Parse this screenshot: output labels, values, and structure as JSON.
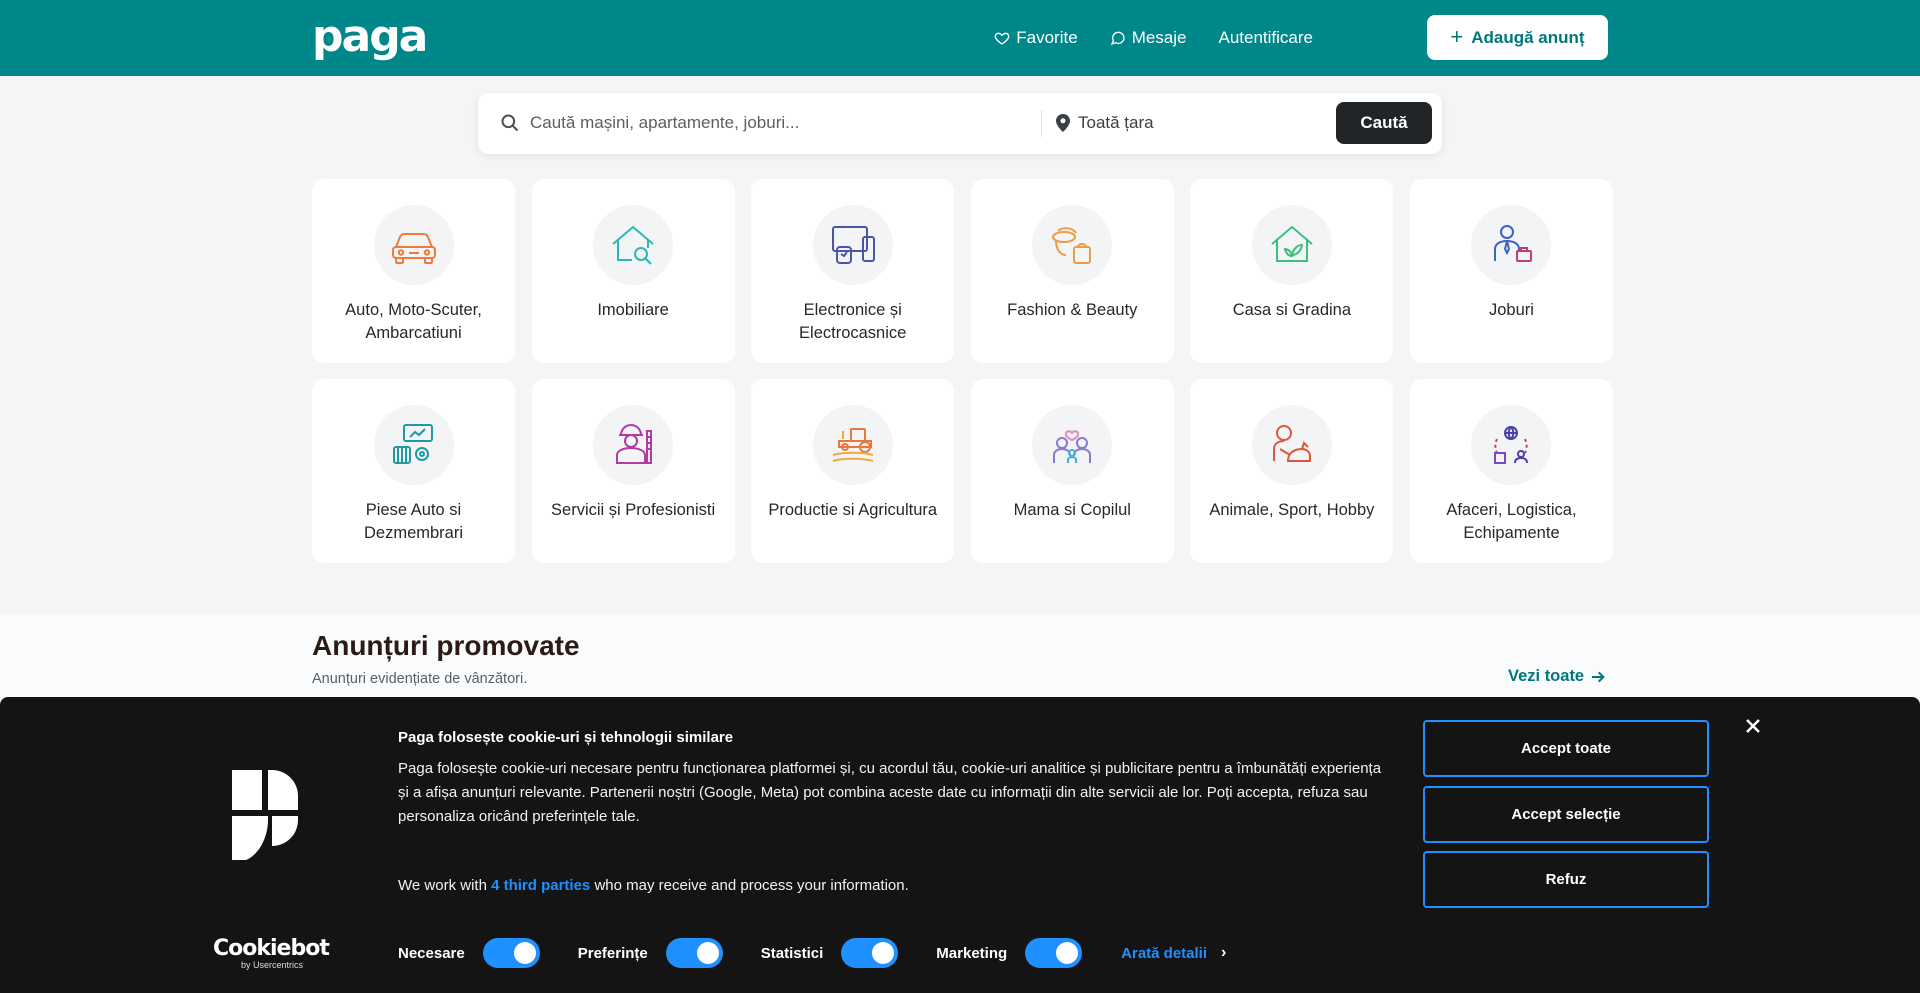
{
  "header": {
    "logo": "paga",
    "nav": {
      "favorites": "Favorite",
      "messages": "Mesaje",
      "login": "Autentificare"
    },
    "add_listing": "Adaugă anunț",
    "bg_color": "#00878a"
  },
  "search": {
    "placeholder": "Caută mașini, apartamente, joburi...",
    "location": "Toată țara",
    "button": "Caută"
  },
  "categories": [
    {
      "label": "Auto, Moto-Scuter, Ambarcatiuni",
      "icon": "car-icon"
    },
    {
      "label": "Imobiliare",
      "icon": "house-search-icon"
    },
    {
      "label": "Electronice și Electrocasnice",
      "icon": "devices-icon"
    },
    {
      "label": "Fashion & Beauty",
      "icon": "fashion-icon"
    },
    {
      "label": "Casa si Gradina",
      "icon": "house-leaf-icon"
    },
    {
      "label": "Joburi",
      "icon": "worker-briefcase-icon"
    },
    {
      "label": "Piese Auto si Dezmembrari",
      "icon": "car-parts-icon"
    },
    {
      "label": "Servicii și Profesionisti",
      "icon": "builder-icon"
    },
    {
      "label": "Productie si Agricultura",
      "icon": "tractor-icon"
    },
    {
      "label": "Mama si Copilul",
      "icon": "family-icon"
    },
    {
      "label": "Animale, Sport, Hobby",
      "icon": "pet-icon"
    },
    {
      "label": "Afaceri, Logistica, Echipamente",
      "icon": "logistics-icon"
    }
  ],
  "promoted": {
    "title": "Anunțuri promovate",
    "subtitle": "Anunțuri evidențiate de vânzători.",
    "see_all": "Vezi toate"
  },
  "cookie": {
    "title": "Paga folosește cookie-uri și tehnologii similare",
    "body": "Paga folosește cookie-uri necesare pentru funcționarea platformei și, cu acordul tău, cookie-uri analitice și publicitare pentru a îmbunătăți experiența și a afișa anunțuri relevante. Partenerii noștri (Google, Meta) pot combina aceste date cu informații din alte servicii ale lor. Poți accepta, refuza sau personaliza oricând preferințele tale.",
    "parties_pre": "We work with ",
    "parties_link": "4 third parties",
    "parties_post": " who may receive and process your information.",
    "toggles": {
      "necessary": "Necesare",
      "preferences": "Preferințe",
      "statistics": "Statistici",
      "marketing": "Marketing"
    },
    "details": "Arată detalii",
    "accept_all": "Accept toate",
    "accept_selection": "Accept selecție",
    "refuse": "Refuz",
    "brand": "Cookiebot",
    "brand_sub": "by Usercentrics",
    "accent": "#1e90ff"
  }
}
